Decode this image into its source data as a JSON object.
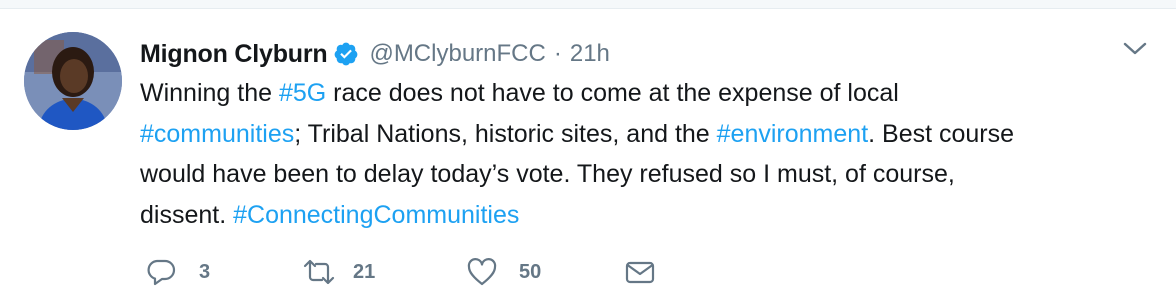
{
  "tweet": {
    "author_name": "Mignon Clyburn",
    "handle": "@MClyburnFCC",
    "separator": "·",
    "time": "21h",
    "text_segments": [
      [
        "Winning the ",
        "#5G",
        " race does not have to come at the expense of local"
      ],
      [
        "#communities",
        "; Tribal Nations, historic sites, and the ",
        "#environment",
        ". Best course"
      ],
      [
        "would have been to delay today’s vote. They refused so I must, of course,"
      ],
      [
        "dissent. ",
        "#ConnectingCommunities"
      ]
    ],
    "actions": {
      "reply_count": "3",
      "retweet_count": "21",
      "like_count": "50"
    }
  },
  "icons": {
    "verified": "verified-badge-icon",
    "caret": "chevron-down-icon",
    "reply": "reply-icon",
    "retweet": "retweet-icon",
    "like": "heart-icon",
    "dm": "envelope-icon"
  },
  "colors": {
    "link": "#1da1f2",
    "secondary": "#657786",
    "text": "#14171a"
  }
}
